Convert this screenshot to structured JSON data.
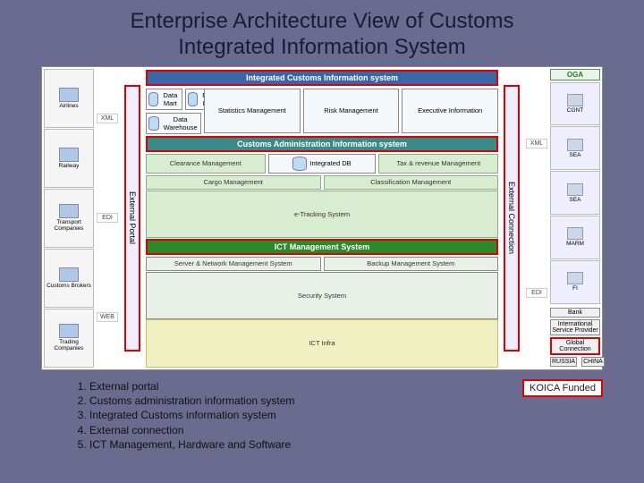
{
  "title_line1": "Enterprise Architecture View of Customs",
  "title_line2": "Integrated Information System",
  "left_partners": [
    "Airlines",
    "Railway",
    "Transport Companies",
    "Customs Brokers",
    "Trading Companies"
  ],
  "left_conn": [
    "XML",
    "EDI",
    "WEB"
  ],
  "portal_label": "External Portal",
  "ext_conn_label": "External Connection",
  "top_band": "Integrated Customs Information system",
  "data_marts": [
    "Data Mart",
    "Data Mart"
  ],
  "top_modules": [
    "Statistics Management",
    "Risk Management",
    "Executive Information"
  ],
  "data_wh": "Data Warehouse",
  "admin_band": "Customs Administration Information system",
  "clearance": "Clearance Management",
  "cargo": "Cargo Management",
  "int_db": "Integrated DB",
  "tax": "Tax & revenue Management",
  "classification": "Classification Management",
  "etracking": "e-Tracking System",
  "ict_band": "ICT Management System",
  "servernet": "Server & Network Management System",
  "backup": "Backup Management System",
  "security": "Security System",
  "ictinfra": "ICT Infra",
  "right_conn": [
    "XML",
    "EDI"
  ],
  "oga": "OGA",
  "right_cells": [
    "CGNT",
    "SEA",
    "SEA",
    "MARM",
    "FI"
  ],
  "isp_label": "International Service Provider",
  "glob_label": "Global Connection",
  "glob_items": [
    "RUSSIA",
    "CHINA"
  ],
  "bank": "Bank",
  "list": [
    "External portal",
    "Customs administration information system",
    "Integrated Customs information system",
    "External connection",
    "ICT Management, Hardware and Software"
  ],
  "koica": "KOICA Funded"
}
